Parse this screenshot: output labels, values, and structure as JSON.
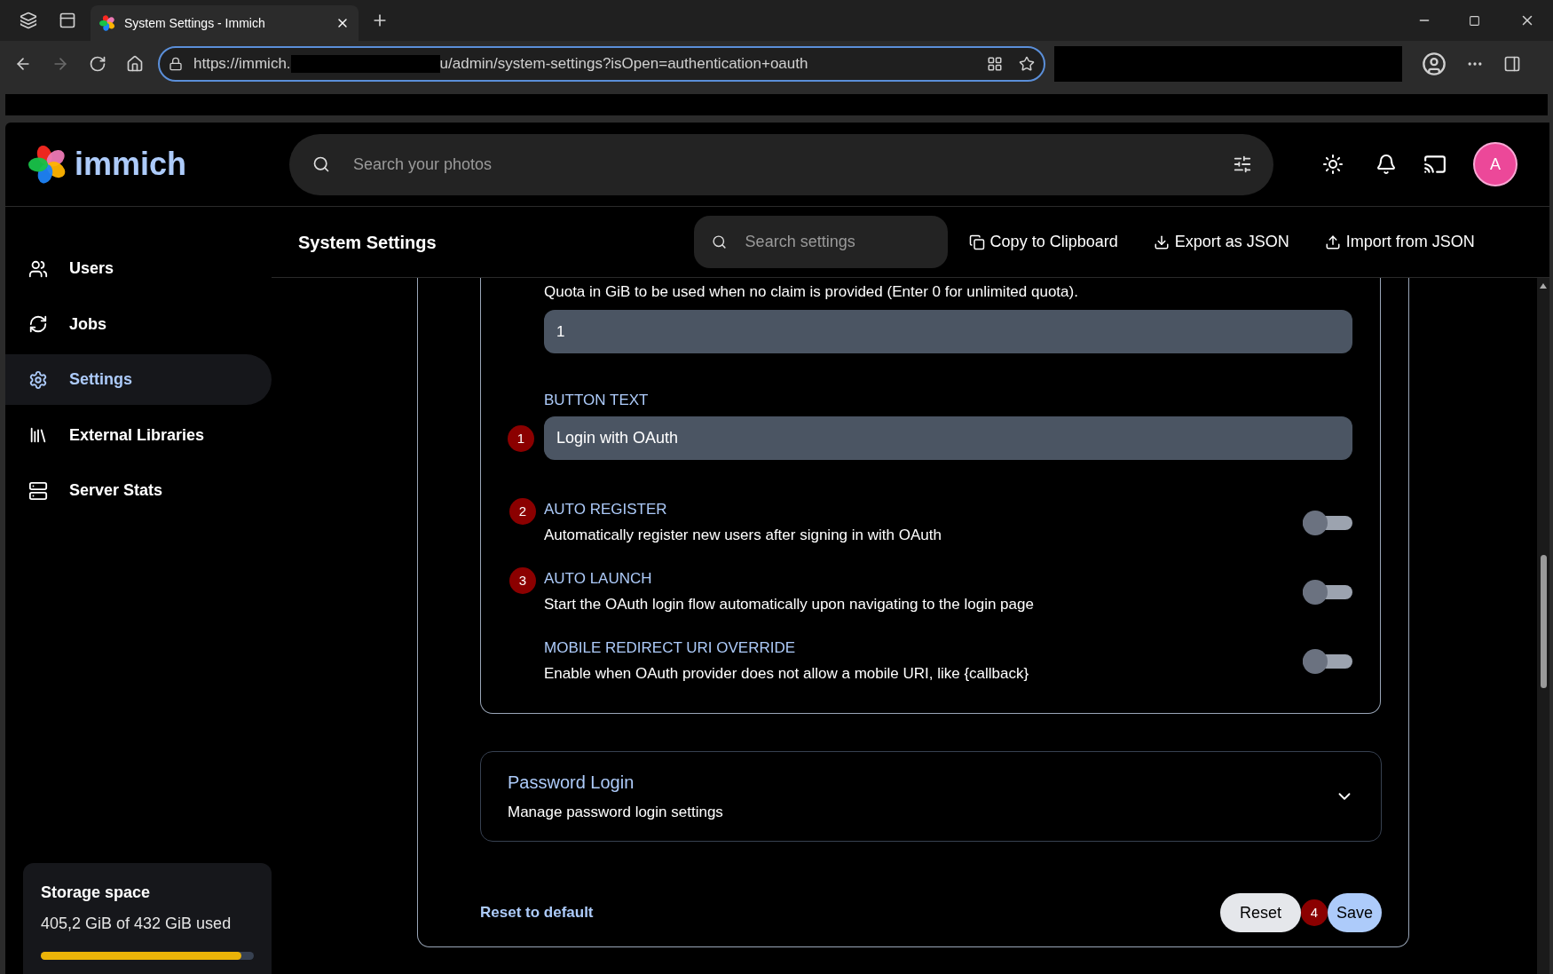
{
  "browser": {
    "tab_title": "System Settings - Immich",
    "url_start": "https://immich.",
    "url_end": "u/admin/system-settings?isOpen=authentication+oauth"
  },
  "header": {
    "logo_text": "immich",
    "search_placeholder": "Search your photos",
    "avatar": "A"
  },
  "sidebar": {
    "items": [
      {
        "label": "Users",
        "selected": false
      },
      {
        "label": "Jobs",
        "selected": false
      },
      {
        "label": "Settings",
        "selected": true
      },
      {
        "label": "External Libraries",
        "selected": false
      },
      {
        "label": "Server Stats",
        "selected": false
      }
    ],
    "storage": {
      "title": "Storage space",
      "usage": "405,2 GiB of 432 GiB used",
      "level": 0.94
    }
  },
  "toolbar": {
    "title": "System Settings",
    "search_placeholder": "Search settings",
    "actions": [
      {
        "label": "Copy to Clipboard"
      },
      {
        "label": "Export as JSON"
      },
      {
        "label": "Import from JSON"
      }
    ]
  },
  "oauth": {
    "quota_hint": "Quota in GiB to be used when no claim is provided (Enter 0 for unlimited quota).",
    "quota_value": "1",
    "button_text_label": "BUTTON TEXT",
    "button_text_value": "Login with OAuth",
    "button_text_marker": "1",
    "toggles": [
      {
        "title": "AUTO REGISTER",
        "description": "Automatically register new users after signing in with OAuth",
        "on": false,
        "marker": "2"
      },
      {
        "title": "AUTO LAUNCH",
        "description": "Start the OAuth login flow automatically upon navigating to the login page",
        "on": false,
        "marker": "3"
      },
      {
        "title": "MOBILE REDIRECT URI OVERRIDE",
        "description": "Enable when OAuth provider does not allow a mobile URI, like {callback}",
        "on": false
      }
    ]
  },
  "password_login": {
    "title": "Password Login",
    "description": "Manage password login settings",
    "expanded": false
  },
  "footer": {
    "reset_default": "Reset to default",
    "reset": "Reset",
    "save": "Save",
    "save_marker": "4"
  }
}
